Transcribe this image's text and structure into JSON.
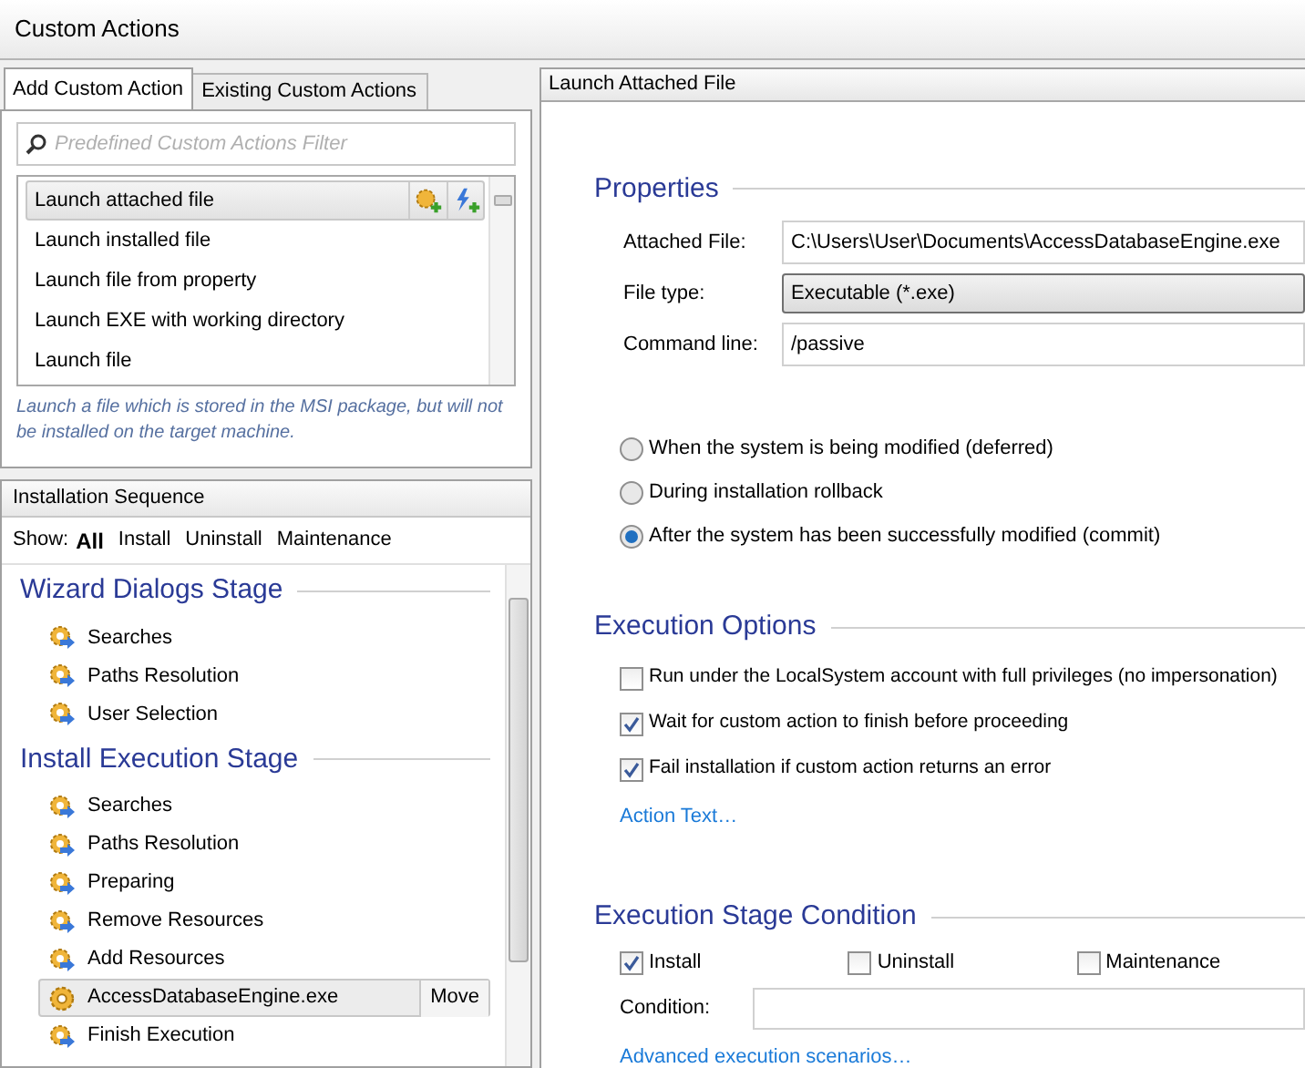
{
  "window": {
    "title": "Custom Actions"
  },
  "left_tabs": [
    {
      "label": "Add Custom Action",
      "selected": true
    },
    {
      "label": "Existing Custom Actions",
      "selected": false
    }
  ],
  "filter": {
    "placeholder": "Predefined Custom Actions Filter"
  },
  "predefined_actions": [
    {
      "label": "Launch attached file",
      "selected": true
    },
    {
      "label": "Launch installed file",
      "selected": false
    },
    {
      "label": "Launch file from property",
      "selected": false
    },
    {
      "label": "Launch EXE with working directory",
      "selected": false
    },
    {
      "label": "Launch file",
      "selected": false
    }
  ],
  "description": "Launch a file which is stored in the MSI package, but will not be installed on the target machine.",
  "sequence": {
    "title": "Installation Sequence",
    "show_label": "Show:",
    "filters": [
      {
        "label": "All",
        "selected": true
      },
      {
        "label": "Install",
        "selected": false
      },
      {
        "label": "Uninstall",
        "selected": false
      },
      {
        "label": "Maintenance",
        "selected": false
      }
    ],
    "stages": [
      {
        "title": "Wizard Dialogs Stage",
        "items": [
          {
            "label": "Searches",
            "kind": "step",
            "selected": false
          },
          {
            "label": "Paths Resolution",
            "kind": "step",
            "selected": false
          },
          {
            "label": "User Selection",
            "kind": "step",
            "selected": false
          }
        ]
      },
      {
        "title": "Install Execution Stage",
        "items": [
          {
            "label": "Searches",
            "kind": "step",
            "selected": false
          },
          {
            "label": "Paths Resolution",
            "kind": "step",
            "selected": false
          },
          {
            "label": "Preparing",
            "kind": "step",
            "selected": false
          },
          {
            "label": "Remove Resources",
            "kind": "step",
            "selected": false
          },
          {
            "label": "Add Resources",
            "kind": "step",
            "selected": false
          },
          {
            "label": "AccessDatabaseEngine.exe",
            "kind": "action",
            "selected": true,
            "action_button": "Move"
          },
          {
            "label": "Finish Execution",
            "kind": "step",
            "selected": false
          }
        ]
      }
    ]
  },
  "panel": {
    "title": "Launch Attached File",
    "properties": {
      "title": "Properties",
      "fields": [
        {
          "label": "Attached File:",
          "value": "C:\\Users\\User\\Documents\\AccessDatabaseEngine.exe",
          "kind": "text"
        },
        {
          "label": "File type:",
          "value": "Executable (*.exe)",
          "kind": "dropdown"
        },
        {
          "label": "Command line:",
          "value": "/passive",
          "kind": "text"
        }
      ]
    },
    "run_modes": [
      {
        "label": "When the system is being modified (deferred)",
        "selected": false
      },
      {
        "label": "During installation rollback",
        "selected": false
      },
      {
        "label": "After the system has been successfully modified (commit)",
        "selected": true
      }
    ],
    "execution_options": {
      "title": "Execution Options",
      "checks": [
        {
          "label": "Run under the LocalSystem account with full privileges (no impersonation)",
          "checked": false
        },
        {
          "label": "Wait for custom action to finish before proceeding",
          "checked": true
        },
        {
          "label": "Fail installation if custom action returns an error",
          "checked": true
        }
      ],
      "link": "Action Text…"
    },
    "stage_condition": {
      "title": "Execution Stage Condition",
      "checks": [
        {
          "label": "Install",
          "checked": true
        },
        {
          "label": "Uninstall",
          "checked": false
        },
        {
          "label": "Maintenance",
          "checked": false
        }
      ],
      "condition_label": "Condition:",
      "link": "Advanced execution scenarios…"
    }
  }
}
